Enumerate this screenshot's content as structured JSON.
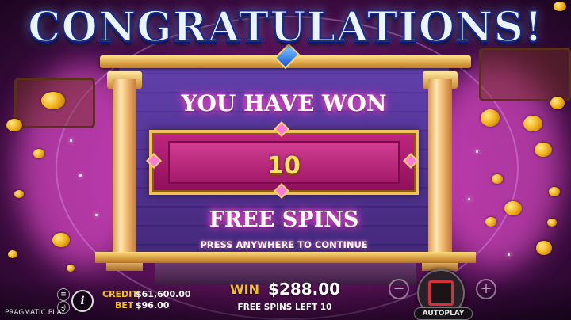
{
  "popup": {
    "title": "CONGRATULATIONS!",
    "you_have_won": "YOU HAVE WON",
    "spins_count": "10",
    "free_spins": "FREE SPINS",
    "press_to_continue": "PRESS ANYWHERE TO CONTINUE"
  },
  "hud": {
    "credit_label": "CREDIT",
    "credit_value": "$61,600.00",
    "bet_label": "BET",
    "bet_value": "$96.00",
    "win_label": "WIN",
    "win_value": "$288.00",
    "free_spins_left": "FREE SPINS LEFT 10",
    "minus_symbol": "−",
    "plus_symbol": "+",
    "autoplay_label": "AUTOPLAY",
    "info_symbol": "i",
    "menu_symbol": "≡",
    "sound_symbol": "◂)"
  },
  "brand": "PRAGMATIC PLAY",
  "icons": [
    "menu-icon",
    "sound-icon",
    "info-icon",
    "minus-icon",
    "plus-icon",
    "stop-icon",
    "autoplay-icon",
    "gem-icon"
  ],
  "colors": {
    "title_fill": "#eaf4ff",
    "title_outline": "#1a2a8a",
    "gold": "#f4c021",
    "win_box": "#c0267e",
    "number": "#ffe15a",
    "stop_button": "#d4303a"
  }
}
